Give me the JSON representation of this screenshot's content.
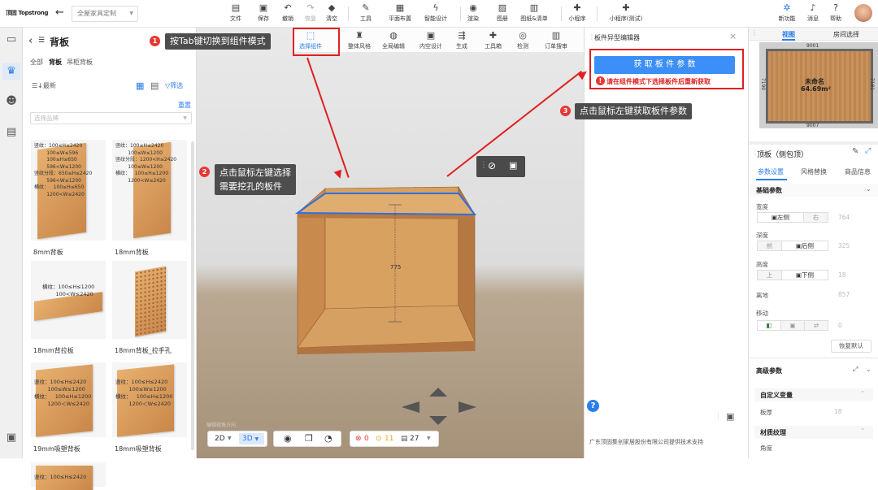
{
  "topbar": {
    "logo": "顶固 Topstrong",
    "plan_name": "全屋家具定制",
    "tools": [
      {
        "name": "file",
        "label": "文件",
        "icon": "file-icon"
      },
      {
        "name": "save",
        "label": "保存",
        "icon": "save-icon"
      },
      {
        "name": "undo",
        "label": "撤销",
        "icon": "undo-icon"
      },
      {
        "name": "redo",
        "label": "恢复",
        "icon": "redo-icon"
      },
      {
        "name": "clear",
        "label": "清空",
        "icon": "eraser-icon"
      },
      {
        "name": "tools",
        "label": "工具",
        "icon": "wrench-icon"
      },
      {
        "name": "floorplan",
        "label": "平面布置",
        "icon": "floorplan-icon"
      },
      {
        "name": "smart",
        "label": "智能设计",
        "icon": "bolt-icon"
      },
      {
        "name": "render",
        "label": "渲染",
        "icon": "camera-icon"
      },
      {
        "name": "gallery",
        "label": "图册",
        "icon": "gallery-icon"
      },
      {
        "name": "drawings",
        "label": "图纸&清单",
        "icon": "drawings-icon"
      },
      {
        "name": "miniprogram",
        "label": "小程序",
        "icon": "puzzle-icon"
      },
      {
        "name": "miniprogram-test",
        "label": "小程序(测试)",
        "icon": "puzzle-icon"
      }
    ],
    "right": [
      {
        "name": "new-features",
        "label": "新功能"
      },
      {
        "name": "messages",
        "label": "消息"
      },
      {
        "name": "help",
        "label": "帮助"
      }
    ]
  },
  "catalog": {
    "title": "背板",
    "tabs": [
      "全部",
      "背板",
      "吊柜背板"
    ],
    "sort_label": "最新",
    "filter_label": "筛选",
    "reset_label": "重置",
    "brand_placeholder": "选择品牌",
    "items": [
      {
        "name": "8mm背板",
        "dims": "竖纹：100≤H≤2420\n        100≤W≤596\n        100≤H≤650\n        596<W≤1200\n竖纹分段：650≤H≤2420\n        596<W≤1200\n横纹：   100≤H≤650\n        1200<W≤2420"
      },
      {
        "name": "18mm背板",
        "dims": "竖纹：100≤H≤2420\n        100≤W≤1200\n竖纹分段：1200<H≤2420\n        100≤W≤1200\n横纹：   100≤H≤1200\n        1200<W≤2420"
      },
      {
        "name": "18mm背拉板",
        "dims": "横纹：100≤H≤1200\n        100<W≤2420"
      },
      {
        "name": "18mm背板_拉手孔",
        "dims": ""
      },
      {
        "name": "19mm吸塑背板",
        "dims": "竖纹：100≤H≤2420\n        100≤W≤1200\n横纹：   100≤H≤1200\n        1200＜W≤2420"
      },
      {
        "name": "18mm吸塑背板",
        "dims": "竖纹：100≤H≤2420\n        100≤W≤1200\n横纹：   100≤H≤1200\n        1200＜W≤2420"
      },
      {
        "name": "",
        "dims": "竖纹：100≤H≤2420"
      }
    ]
  },
  "viewport_tools": [
    {
      "name": "select-component",
      "label": "选择组件"
    },
    {
      "name": "style",
      "label": "整体风格"
    },
    {
      "name": "global-edit",
      "label": "全局编辑"
    },
    {
      "name": "inner-design",
      "label": "内空设计"
    },
    {
      "name": "generate",
      "label": "生成"
    },
    {
      "name": "toolbox",
      "label": "工具箱"
    },
    {
      "name": "check",
      "label": "检测"
    },
    {
      "name": "order-review",
      "label": "订单搜审"
    }
  ],
  "model": {
    "height_label": "775"
  },
  "bottom": {
    "mode_2d": "2D",
    "mode_3d": "3D",
    "errors": "0",
    "warnings": "11",
    "count": "27",
    "watermark": "编辑视角方向"
  },
  "editor": {
    "title": "板件异型编辑器",
    "fetch_button": "获 取 板 件 参 数",
    "warning": "请在组件模式下选择板件后重新获取",
    "footer": "广东顶固集创家居股份有限公司提供技术支持"
  },
  "annotations": [
    {
      "num": "1",
      "text": "按Tab键切换到组件模式"
    },
    {
      "num": "2",
      "text": "点击鼠标左键选择\n需要挖孔的板件"
    },
    {
      "num": "3",
      "text": "点击鼠标左键获取板件参数"
    }
  ],
  "minimap": {
    "tab_view": "视图",
    "tab_room": "房间选择",
    "room_name": "未命名",
    "area": "64.69m²",
    "dim_top": "9001",
    "dim_bottom": "9007",
    "dim_left": "7190",
    "dim_right": "7181"
  },
  "props": {
    "title": "顶板（侧包顶）",
    "tabs": [
      "参数设置",
      "风格替换",
      "商品信息"
    ],
    "basic_title": "基础参数",
    "width_label": "宽度",
    "width_opts": [
      "左侧",
      "右"
    ],
    "width_val": "764",
    "depth_label": "深度",
    "depth_opts": [
      "前",
      "后侧"
    ],
    "depth_val": "325",
    "height_label": "高度",
    "height_opts": [
      "上",
      "下侧"
    ],
    "height_val": "18",
    "ground_label": "离地",
    "ground_val": "857",
    "move_label": "移动",
    "move_val": "0",
    "reset_btn": "恢复默认",
    "advanced_title": "高级参数",
    "custom_title": "自定义变量",
    "thickness_label": "板厚",
    "thickness_val": "18",
    "material_title": "材质纹理",
    "angle_label": "角度"
  },
  "colors": {
    "accent": "#1890ff",
    "annotation": "#e02020",
    "button": "#3b8ff7"
  }
}
